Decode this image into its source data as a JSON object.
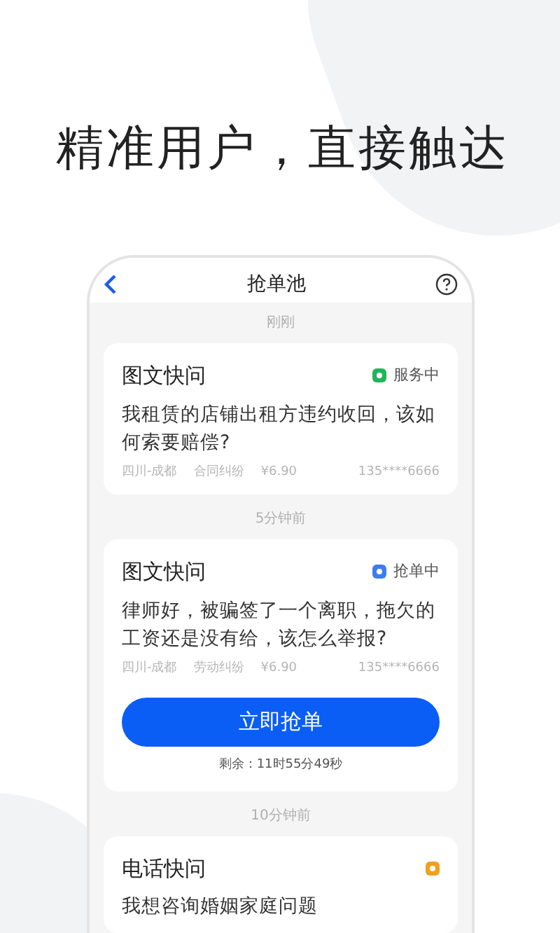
{
  "headline": "精准用户，直接触达",
  "nav": {
    "title": "抢单池"
  },
  "orders": [
    {
      "time_label": "刚刚",
      "type": "图文快问",
      "status": {
        "text": "服务中",
        "color": "#22b45a"
      },
      "question": "我租赁的店铺出租方违约收回，该如何索要赔偿?",
      "location": "四川-成都",
      "category": "合同纠纷",
      "price": "¥6.90",
      "phone": "135****6666"
    },
    {
      "time_label": "5分钟前",
      "type": "图文快问",
      "status": {
        "text": "抢单中",
        "color": "#3d7cf0"
      },
      "question": "律师好，被骗签了一个离职，拖欠的工资还是没有给，该怎么举报?",
      "location": "四川-成都",
      "category": "劳动纠纷",
      "price": "¥6.90",
      "phone": "135****6666",
      "action": "立即抢单",
      "remaining": "剩余：11时55分49秒"
    },
    {
      "time_label": "10分钟前",
      "type": "电话快问",
      "status": {
        "color": "#f0a020"
      },
      "question": "我想咨询婚姻家庭问题"
    }
  ]
}
